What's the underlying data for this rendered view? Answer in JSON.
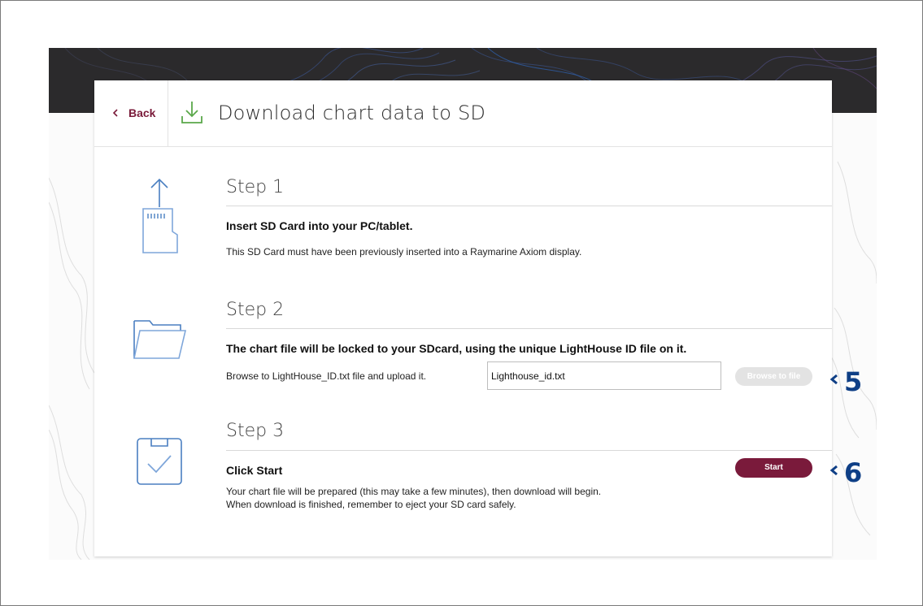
{
  "header": {
    "back_label": "Back",
    "title": "Download chart data to SD"
  },
  "steps": [
    {
      "title": "Step 1",
      "heading": "Insert SD Card into your PC/tablet.",
      "body": "This SD Card must have been previously inserted into a Raymarine Axiom display.",
      "icon": "sd-card-upload-icon"
    },
    {
      "title": "Step 2",
      "heading": "The chart file will be locked to your SDcard, using the unique LightHouse ID file on it.",
      "body": "Browse to LightHouse_ID.txt file and upload it.",
      "file_value": "Lighthouse_id.txt",
      "browse_label": "Browse to file",
      "icon": "folder-icon"
    },
    {
      "title": "Step 3",
      "heading": "Click Start",
      "body_line1": "Your chart file will be prepared (this may take a few minutes), then download will begin.",
      "body_line2": "When download is finished, remember to eject your SD card safely.",
      "start_label": "Start",
      "icon": "clipboard-check-icon"
    }
  ],
  "callouts": [
    "5",
    "6"
  ],
  "colors": {
    "accent": "#7a1a3b",
    "icon_blue": "#4a7fc1",
    "download_green": "#5aa84a",
    "callout_blue": "#0f3f86"
  }
}
